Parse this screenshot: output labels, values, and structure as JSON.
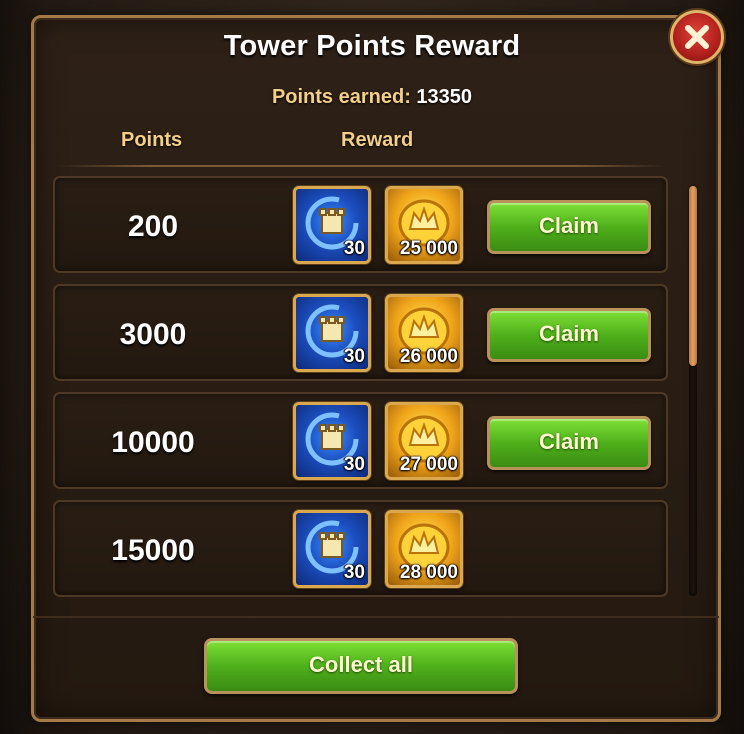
{
  "dialog": {
    "title": "Tower Points Reward",
    "points_earned_label": "Points earned:",
    "points_earned_value": "13350",
    "columns": {
      "points": "Points",
      "reward": "Reward"
    },
    "close_icon": "close-icon"
  },
  "rows": [
    {
      "points": "200",
      "tower_qty": "30",
      "gold_qty": "25 000",
      "claim_label": "Claim"
    },
    {
      "points": "3000",
      "tower_qty": "30",
      "gold_qty": "26 000",
      "claim_label": "Claim"
    },
    {
      "points": "10000",
      "tower_qty": "30",
      "gold_qty": "27 000",
      "claim_label": "Claim"
    },
    {
      "points": "15000",
      "tower_qty": "30",
      "gold_qty": "28 000"
    }
  ],
  "icons": {
    "tower_item": "tower-token-icon",
    "gold_item": "gold-coin-icon"
  },
  "footer": {
    "collect_all_label": "Collect all"
  },
  "colors": {
    "accent_gold": "#f3cf8a",
    "button_green": "#4fb01c",
    "frame": "#a57a48",
    "close_red": "#b0201c"
  }
}
